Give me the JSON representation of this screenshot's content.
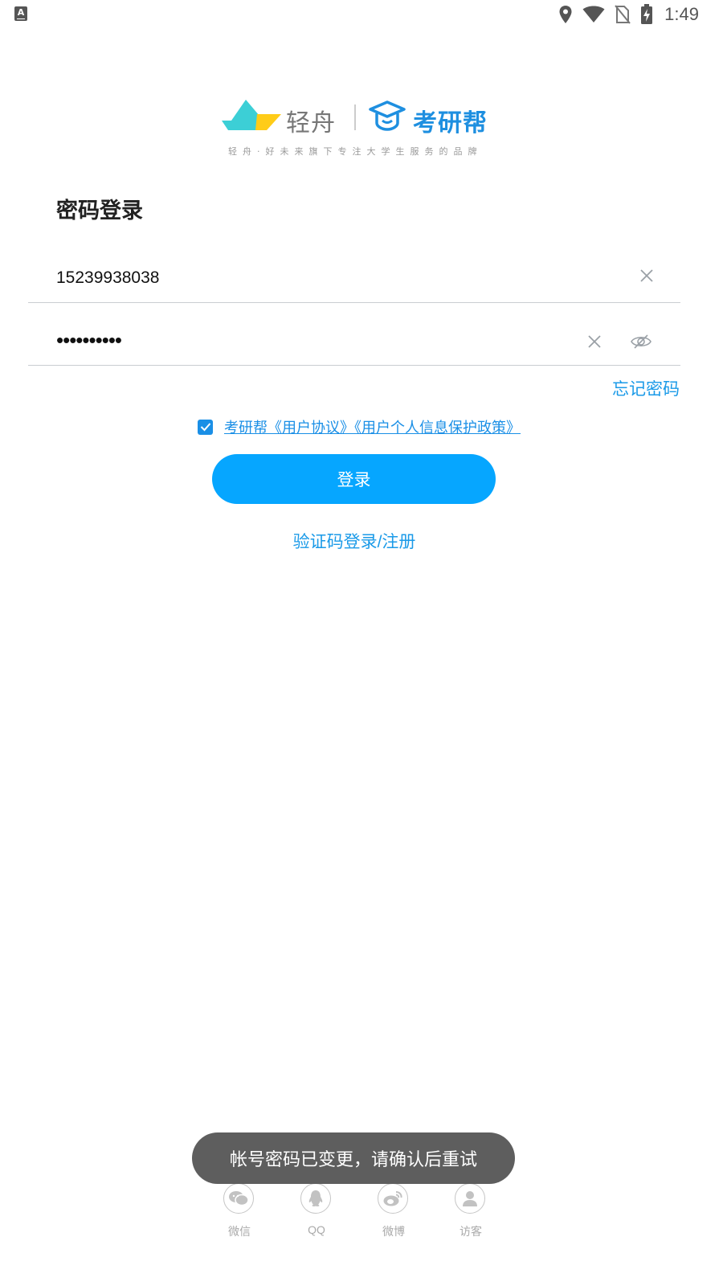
{
  "status_bar": {
    "app_badge": "A",
    "time": "1:49",
    "icons": [
      "location-icon",
      "wifi-icon",
      "no-sim-icon",
      "battery-charging-icon"
    ]
  },
  "brand": {
    "name_left": "轻舟",
    "name_right": "考研帮",
    "tagline": "轻舟·好未来旗下专注大学生服务的品牌",
    "colors": {
      "accent": "#1e8fe0",
      "logo_teal": "#3ccfd6",
      "logo_yellow": "#ffcc18"
    }
  },
  "page": {
    "title": "密码登录"
  },
  "form": {
    "phone_value": "15239938038",
    "password_masked": "••••••••••",
    "forgot_password": "忘记密码",
    "agreement_checked": true,
    "agreement_text": "考研帮《用户协议》《用户个人信息保护政策》",
    "login_button": "登录",
    "sms_login_link": "验证码登录/注册"
  },
  "social_login": [
    {
      "label": "微信",
      "icon": "wechat-icon"
    },
    {
      "label": "QQ",
      "icon": "qq-icon"
    },
    {
      "label": "微博",
      "icon": "weibo-icon"
    },
    {
      "label": "访客",
      "icon": "guest-icon"
    }
  ],
  "toast": {
    "message": "帐号密码已变更，请确认后重试"
  },
  "colors": {
    "primary_button": "#06a6ff",
    "link": "#1a9ae8",
    "toast_bg": "#5e5e5e"
  }
}
